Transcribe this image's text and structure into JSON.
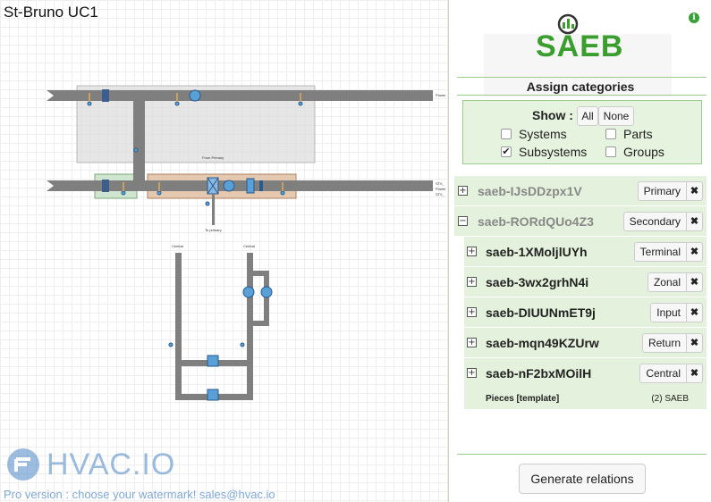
{
  "canvas": {
    "title": "St-Bruno UC1",
    "diagram_labels": {
      "from_primary": "From Primary",
      "to_primary": "To primary",
      "central_left": "Central",
      "central_right": "Central",
      "power_top": "Power",
      "right_labels": [
        "ST0_",
        "Power",
        "ST0_"
      ]
    },
    "watermark": {
      "logo_text": "HVAC.IO",
      "pro_text": "Pro version : choose your watermark! sales@hvac.io"
    }
  },
  "panel": {
    "info_icon": "i",
    "logo_text": "SAEB",
    "heading": "Assign categories",
    "show_label": "Show :",
    "all_button": "All",
    "none_button": "None",
    "checkboxes": [
      {
        "label": "Systems",
        "checked": false
      },
      {
        "label": "Parts",
        "checked": false
      },
      {
        "label": "Subsystems",
        "checked": true
      },
      {
        "label": "Groups",
        "checked": false
      }
    ],
    "rows": [
      {
        "toggle": "+",
        "name": "saeb-IJsDDzpx1V",
        "tag": "Primary",
        "remove": "✖"
      },
      {
        "toggle": "−",
        "name": "saeb-RORdQUo4Z3",
        "tag": "Secondary",
        "remove": "✖"
      },
      {
        "toggle": "+",
        "name": "saeb-1XMoljlUYh",
        "tag": "Terminal",
        "remove": "✖"
      },
      {
        "toggle": "+",
        "name": "saeb-3wx2grhN4i",
        "tag": "Zonal",
        "remove": "✖"
      },
      {
        "toggle": "+",
        "name": "saeb-DIUUNmET9j",
        "tag": "Input",
        "remove": "✖"
      },
      {
        "toggle": "+",
        "name": "saeb-mqn49KZUrw",
        "tag": "Return",
        "remove": "✖"
      },
      {
        "toggle": "+",
        "name": "saeb-nF2bxMOilH",
        "tag": "Central",
        "remove": "✖"
      }
    ],
    "pieces": {
      "label": "Pieces [template]",
      "value": "(2) SAEB"
    },
    "generate_button": "Generate relations"
  },
  "colors": {
    "accent_green": "#3a9e2e",
    "row_bg": "#e4f1dc",
    "duct_gray": "#7f7f7f",
    "watermark_blue": "#4a86c5"
  }
}
